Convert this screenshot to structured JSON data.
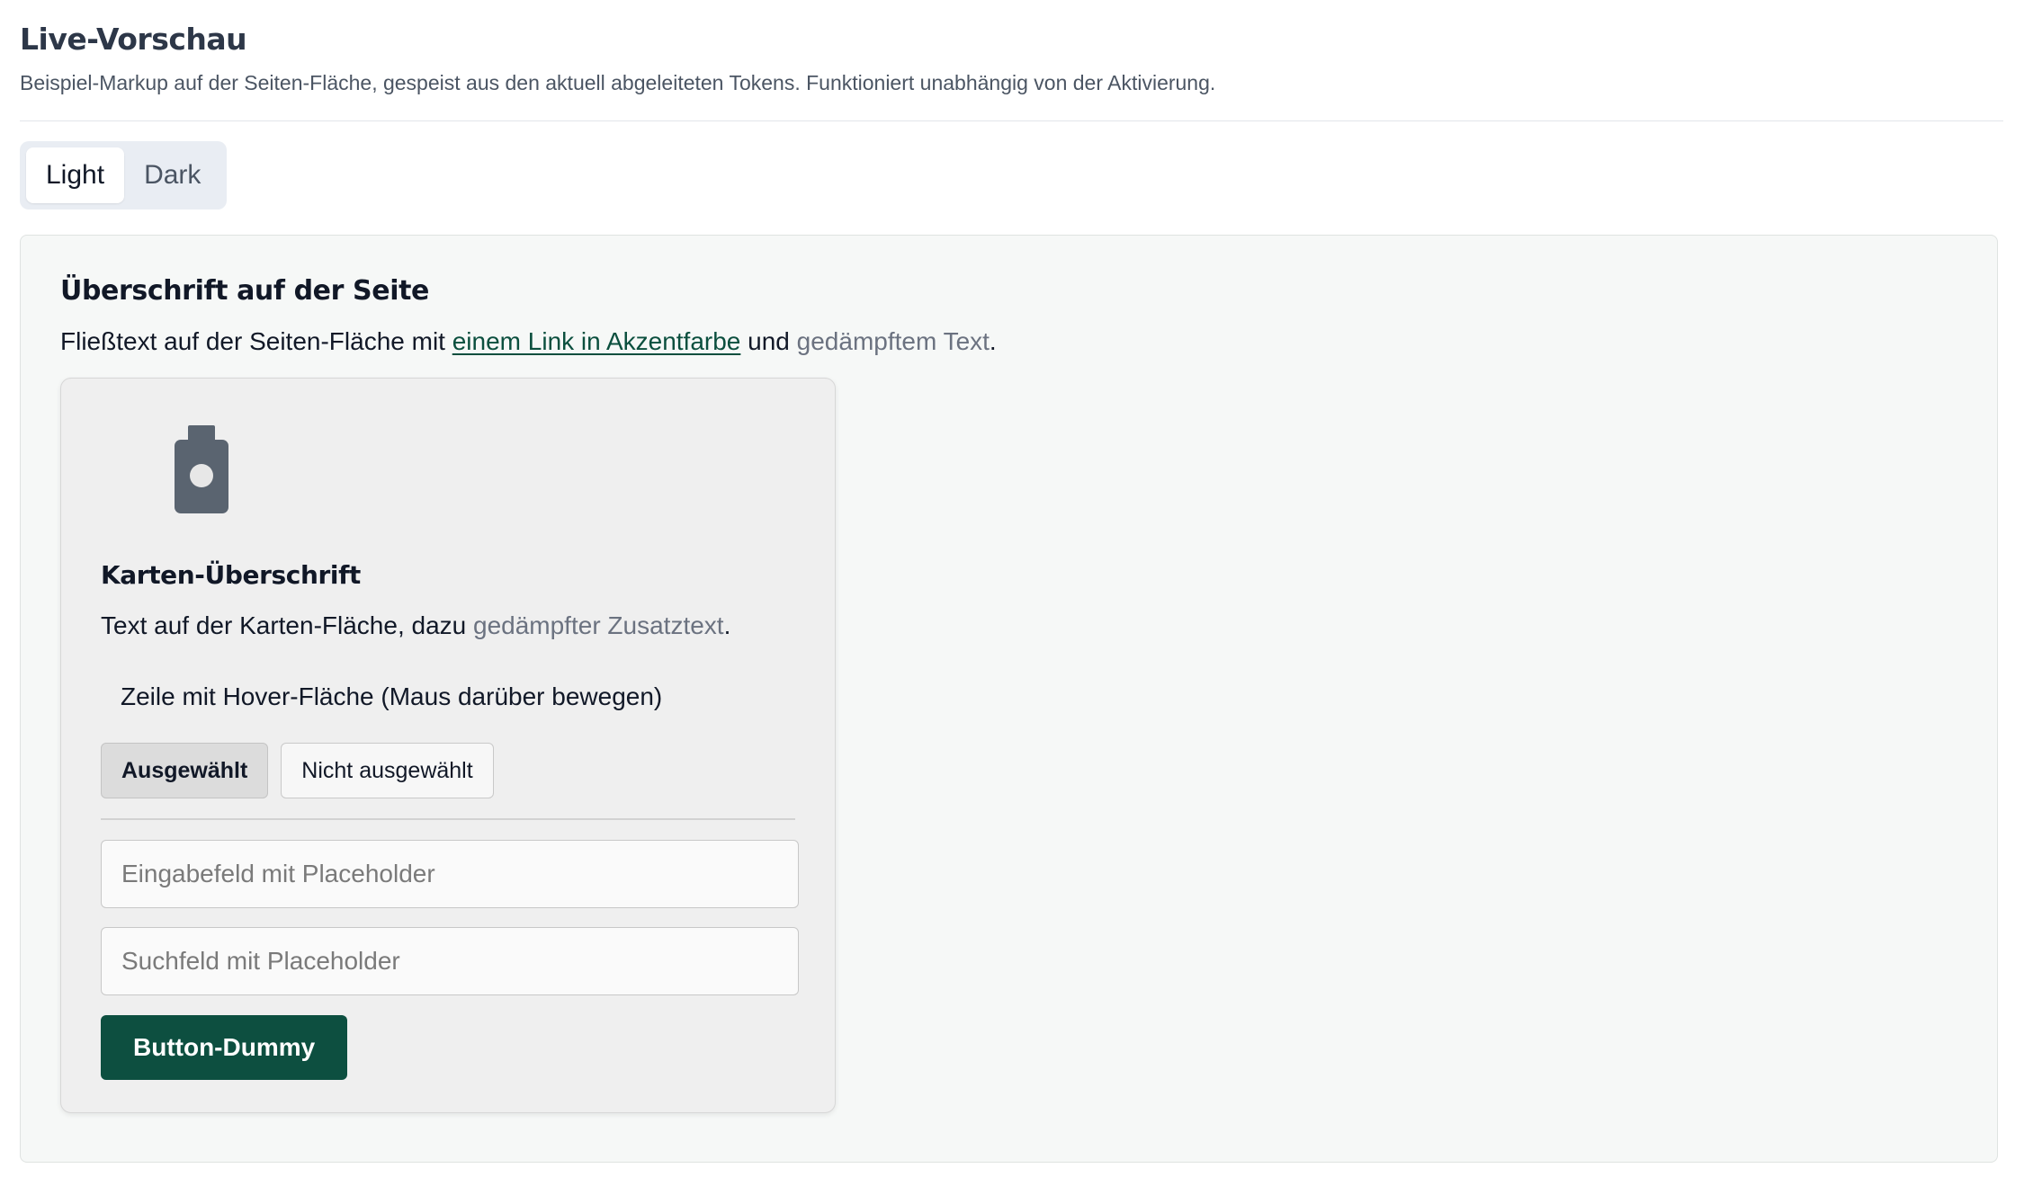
{
  "header": {
    "title": "Live-Vorschau",
    "description": "Beispiel-Markup auf der Seiten-Fläche, gespeist aus den aktuell abgeleiteten Tokens. Funktioniert unabhängig von der Aktivierung."
  },
  "mode_toggle": {
    "options": [
      "Light",
      "Dark"
    ],
    "selected": "Light"
  },
  "preview": {
    "heading": "Überschrift auf der Seite",
    "text_before_link": "Fließtext auf der Seiten-Fläche mit ",
    "link_text": "einem Link in Akzentfarbe",
    "text_between": " und ",
    "muted_text": "gedämpftem Text",
    "text_end": ".",
    "card": {
      "icon": "bottle-icon",
      "heading": "Karten-Überschrift",
      "text_before_muted": "Text auf der Karten-Fläche, dazu ",
      "muted_text": "gedämpfter Zusatztext",
      "text_end": ".",
      "hover_row": "Zeile mit Hover-Fläche (Maus darüber bewegen)",
      "chips": {
        "selected": "Ausgewählt",
        "unselected": "Nicht ausgewählt"
      },
      "input_placeholder": "Eingabefeld mit Placeholder",
      "search_placeholder": "Suchfeld mit Placeholder",
      "button_label": "Button-Dummy"
    }
  },
  "colors": {
    "accent": "#0d4f40",
    "muted_text": "#6b7280",
    "page_surface": "#f6f8f7",
    "card_surface": "#efefef",
    "icon": "#5a6470"
  }
}
